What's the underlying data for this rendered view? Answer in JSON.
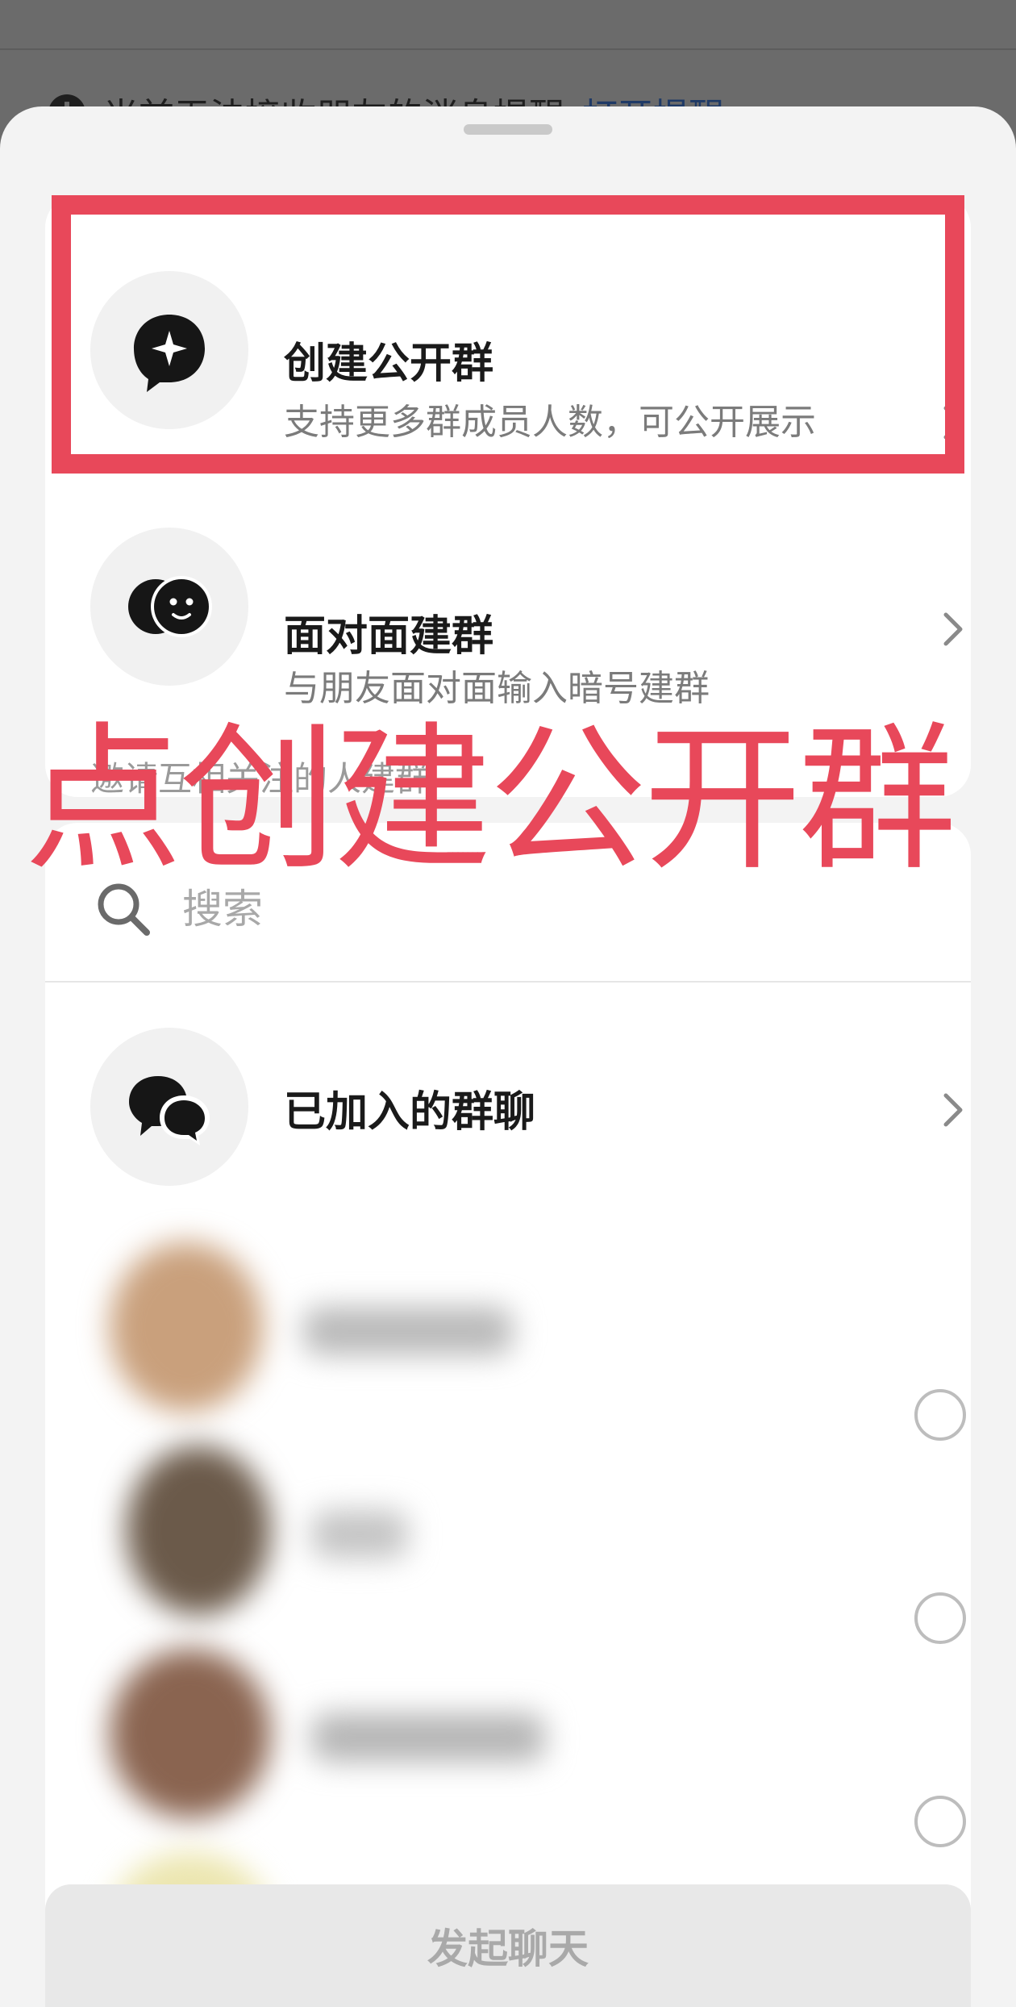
{
  "background": {
    "notice_text": "当前无法接收朋友的消息提醒",
    "notice_link": "打开提醒 >"
  },
  "options": [
    {
      "title": "创建公开群",
      "subtitle": "支持更多群成员人数，可公开展示",
      "icon": "sparkle-chat-icon"
    },
    {
      "title": "面对面建群",
      "subtitle": "与朋友面对面输入暗号建群",
      "icon": "face-to-face-icon"
    }
  ],
  "annotation": {
    "caption": "点创建公开群",
    "color": "#e8485a"
  },
  "section_label": "邀请互相关注的人建群",
  "search": {
    "placeholder": "搜索"
  },
  "joined_groups": {
    "label": "已加入的群聊",
    "icon": "group-chat-icon"
  },
  "footer": {
    "start_chat_label": "发起聊天"
  }
}
